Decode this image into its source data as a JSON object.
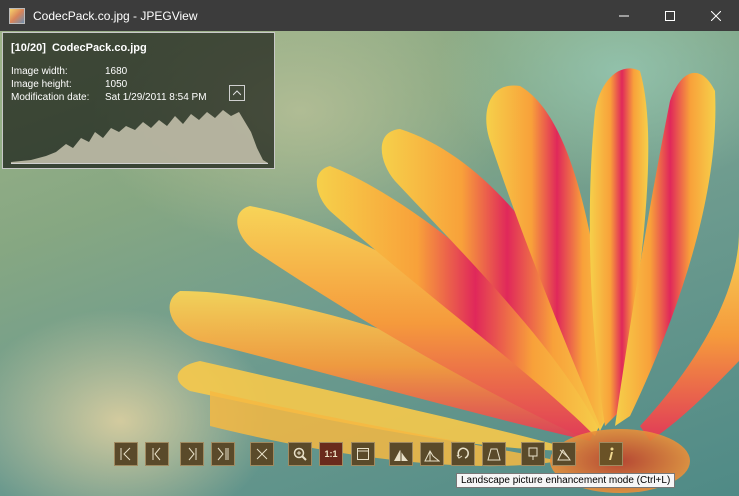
{
  "window": {
    "title": "CodecPack.co.jpg - JPEGView"
  },
  "info_panel": {
    "counter": "[10/20]",
    "filename": "CodecPack.co.jpg",
    "rows": [
      {
        "label": "Image width:",
        "value": "1680"
      },
      {
        "label": "Image height:",
        "value": "1050"
      },
      {
        "label": "Modification date:",
        "value": "Sat 1/29/2011 8:54 PM"
      }
    ]
  },
  "toolbar": {
    "buttons": [
      {
        "name": "first-image",
        "icon": "first-icon"
      },
      {
        "name": "previous-image",
        "icon": "previous-icon"
      },
      {
        "name": "next-image",
        "icon": "next-icon"
      },
      {
        "name": "last-image",
        "icon": "last-icon"
      },
      {
        "name": "delete",
        "icon": "delete-icon"
      },
      {
        "name": "zoom",
        "icon": "zoom-icon"
      },
      {
        "name": "actual-size",
        "label": "1:1"
      },
      {
        "name": "fit-to-window",
        "icon": "fit-window-icon"
      },
      {
        "name": "auto-contrast",
        "icon": "contrast-icon"
      },
      {
        "name": "landscape-enhance",
        "icon": "landscape-icon"
      },
      {
        "name": "rotate",
        "icon": "rotate-icon"
      },
      {
        "name": "perspective",
        "icon": "perspective-icon"
      },
      {
        "name": "keep-params",
        "icon": "keep-params-icon"
      },
      {
        "name": "edit-params",
        "icon": "edit-params-icon"
      },
      {
        "name": "info",
        "icon": "info-icon"
      }
    ]
  },
  "tooltip": {
    "text": "Landscape picture enhancement mode (Ctrl+L)"
  },
  "colors": {
    "titlebar": "#3c3c3c",
    "toolbar_button": "#5a4a2a",
    "toolbar_border": "#a08a60"
  }
}
